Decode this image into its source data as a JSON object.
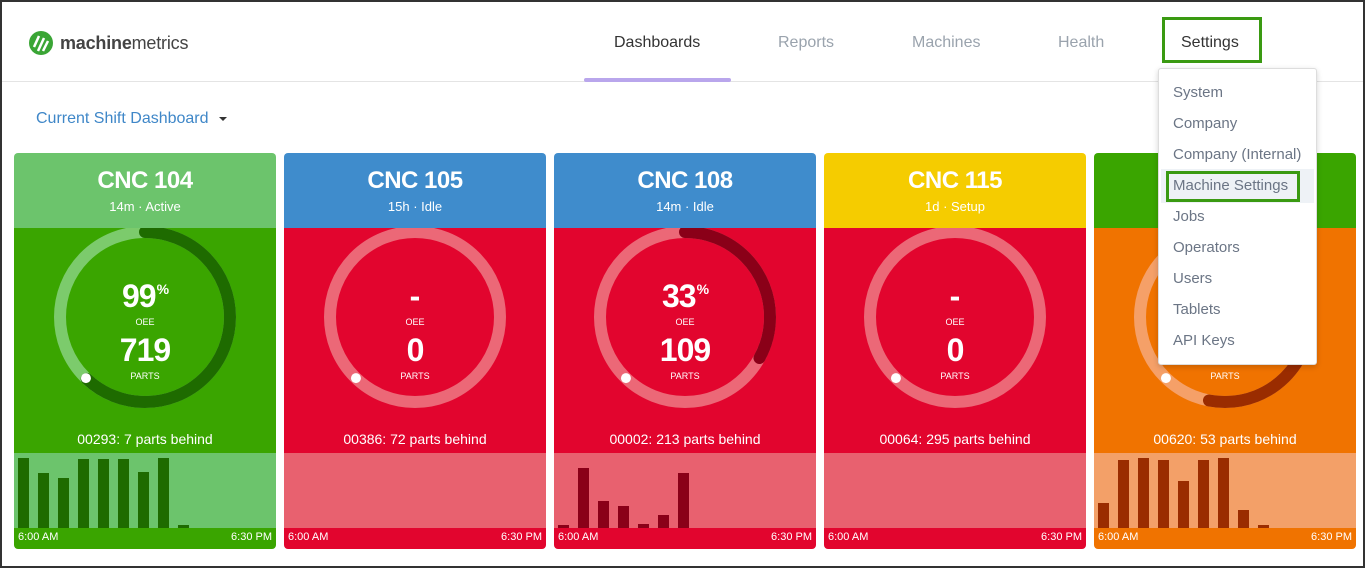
{
  "brand": {
    "name_bold": "machine",
    "name_light": "metrics",
    "logo_color": "#3aa535"
  },
  "nav": {
    "items": [
      {
        "label": "Dashboards",
        "active": true
      },
      {
        "label": "Reports",
        "active": false
      },
      {
        "label": "Machines",
        "active": false
      },
      {
        "label": "Health",
        "active": false
      },
      {
        "label": "Settings",
        "active": false,
        "highlighted": true
      }
    ]
  },
  "dashboard_selector": {
    "value": "Current Shift Dashboard"
  },
  "settings_menu": {
    "items": [
      "System",
      "Company",
      "Company (Internal)",
      "Machine Settings",
      "Jobs",
      "Operators",
      "Users",
      "Tablets",
      "API Keys"
    ],
    "highlighted": "Machine Settings"
  },
  "cards": [
    {
      "name": "CNC 104",
      "status_line": "14m · Active",
      "oee": "99",
      "oee_unit": "%",
      "oee_label": "OEE",
      "parts": "719",
      "parts_label": "PARTS",
      "behind": "00293: 7 parts behind",
      "ring_fill": 0.62,
      "colors": {
        "head": "#6cc46c",
        "body": "#3aa500",
        "track": "#7ccb6c",
        "arc": "#1e6b00",
        "chart": "#6cc46c",
        "bar": "#1e6b00",
        "foot": "#3aa500"
      },
      "bars": [
        93,
        73,
        67,
        92,
        92,
        92,
        75,
        93,
        4
      ],
      "time_start": "6:00 AM",
      "time_end": "6:30 PM"
    },
    {
      "name": "CNC 105",
      "status_line": "15h · Idle",
      "oee": "-",
      "oee_unit": "",
      "oee_label": "OEE",
      "parts": "0",
      "parts_label": "PARTS",
      "behind": "00386: 72 parts behind",
      "ring_fill": 0,
      "colors": {
        "head": "#3f8ccc",
        "body": "#e2052e",
        "track": "#ec6877",
        "arc": "#8a0018",
        "chart": "#e8616f",
        "bar": "#8a0018",
        "foot": "#e2052e"
      },
      "bars": [],
      "time_start": "6:00 AM",
      "time_end": "6:30 PM"
    },
    {
      "name": "CNC 108",
      "status_line": "14m · Idle",
      "oee": "33",
      "oee_unit": "%",
      "oee_label": "OEE",
      "parts": "109",
      "parts_label": "PARTS",
      "behind": "00002: 213 parts behind",
      "ring_fill": 0.33,
      "colors": {
        "head": "#3f8ccc",
        "body": "#e2052e",
        "track": "#ec6877",
        "arc": "#8a0018",
        "chart": "#e8616f",
        "bar": "#8a0018",
        "foot": "#e2052e"
      },
      "bars": [
        4,
        80,
        36,
        29,
        6,
        17,
        73
      ],
      "time_start": "6:00 AM",
      "time_end": "6:30 PM"
    },
    {
      "name": "CNC 115",
      "status_line": "1d · Setup",
      "oee": "-",
      "oee_unit": "",
      "oee_label": "OEE",
      "parts": "0",
      "parts_label": "PARTS",
      "behind": "00064: 295 parts behind",
      "ring_fill": 0,
      "colors": {
        "head": "#f5cc00",
        "body": "#e2052e",
        "track": "#ec6877",
        "arc": "#8a0018",
        "chart": "#e8616f",
        "bar": "#8a0018",
        "foot": "#e2052e"
      },
      "bars": [],
      "time_start": "6:00 AM",
      "time_end": "6:30 PM"
    },
    {
      "name": "",
      "status_line": "",
      "oee": "",
      "oee_unit": "",
      "oee_label": "",
      "parts": "",
      "parts_label": "PARTS",
      "behind": "00620: 53 parts behind",
      "ring_fill": 0.53,
      "colors": {
        "head": "#3aa500",
        "body": "#f07300",
        "track": "#f5a068",
        "arc": "#9a2c00",
        "chart": "#f3a068",
        "bar": "#9a2c00",
        "foot": "#f07300"
      },
      "bars": [
        33,
        91,
        93,
        91,
        63,
        91,
        93,
        24,
        4
      ],
      "time_start": "6:00 AM",
      "time_end": "6:30 PM"
    }
  ]
}
